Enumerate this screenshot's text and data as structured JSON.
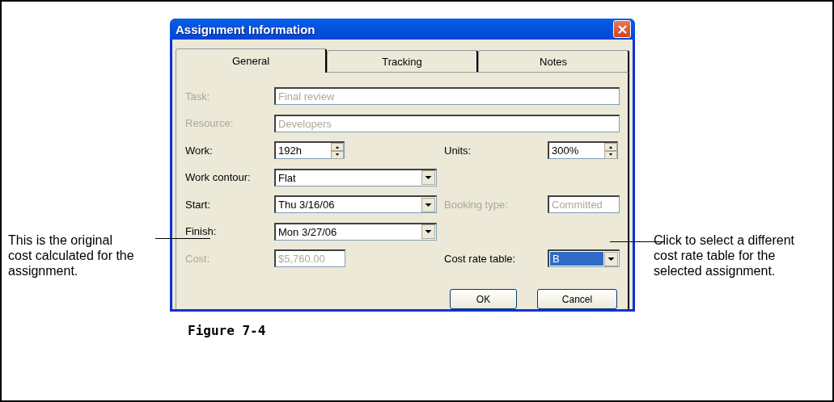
{
  "dialog": {
    "title": "Assignment Information",
    "tabs": [
      {
        "label": "General",
        "selected": true
      },
      {
        "label": "Tracking",
        "selected": false
      },
      {
        "label": "Notes",
        "selected": false
      }
    ],
    "rows": [
      [
        {
          "label": "Task:",
          "kind": "text",
          "value": "Final review",
          "disabled": true,
          "focused": false
        }
      ],
      [
        {
          "label": "Resource:",
          "kind": "text",
          "value": "Developers",
          "disabled": true,
          "focused": false
        }
      ],
      [
        {
          "label": "Work:",
          "kind": "spin",
          "value": "192h",
          "disabled": false,
          "focused": false
        },
        {
          "label": "Units:",
          "kind": "spin",
          "value": "300%",
          "disabled": false,
          "focused": false
        }
      ],
      [
        {
          "label": "Work contour:",
          "kind": "combo",
          "value": "Flat",
          "disabled": false,
          "focused": false
        }
      ],
      [
        {
          "label": "Start:",
          "kind": "combo",
          "value": "Thu 3/16/06",
          "disabled": false,
          "focused": false
        },
        {
          "label": "Booking type:",
          "kind": "text",
          "value": "Committed",
          "disabled": true,
          "focused": false
        }
      ],
      [
        {
          "label": "Finish:",
          "kind": "combo",
          "value": "Mon 3/27/06",
          "disabled": false,
          "focused": false
        }
      ],
      [
        {
          "label": "Cost:",
          "kind": "text",
          "value": "$5,760.00",
          "disabled": true,
          "focused": false
        },
        {
          "label": "Cost rate table:",
          "kind": "combo",
          "value": "B",
          "disabled": false,
          "focused": true
        }
      ]
    ],
    "buttons": [
      "OK",
      "Cancel"
    ]
  },
  "left_callout": "This is the original cost calculated for the assignment.",
  "right_callout": "Click to select a different cost rate table for the selected assignment.",
  "caption": "Figure 7-4"
}
